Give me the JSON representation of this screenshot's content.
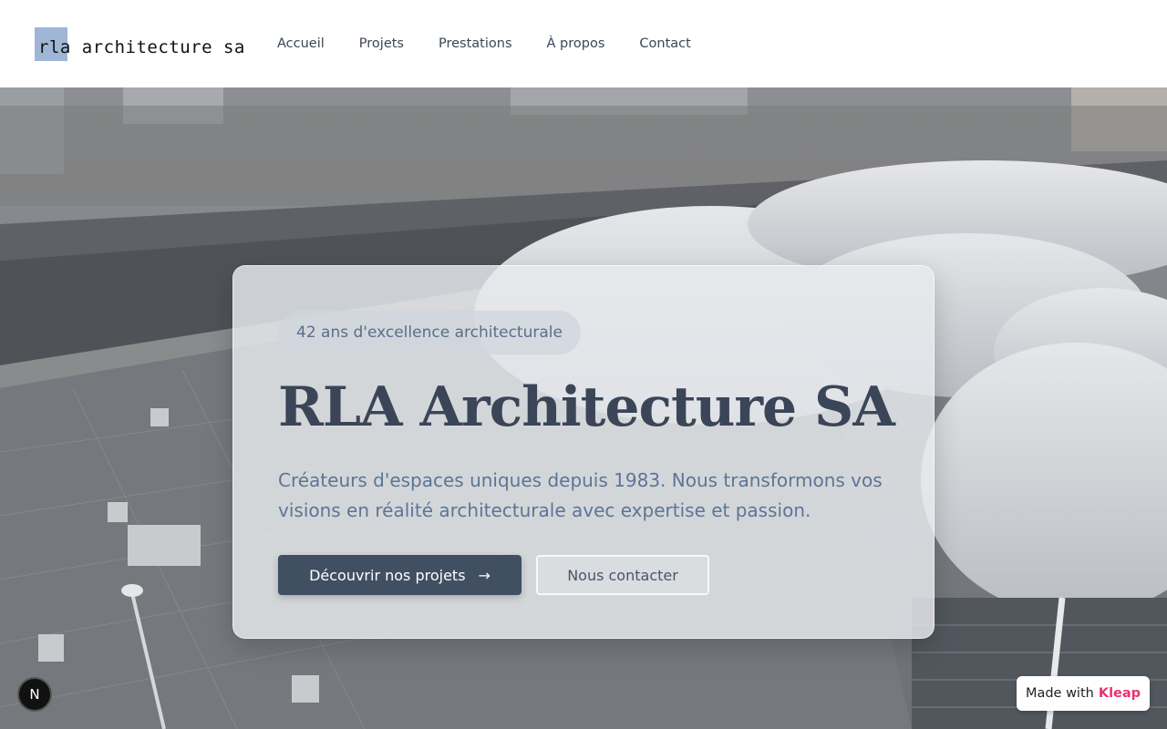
{
  "header": {
    "logo_text": "rla architecture sa",
    "nav": [
      "Accueil",
      "Projets",
      "Prestations",
      "À propos",
      "Contact"
    ]
  },
  "hero": {
    "badge": "42 ans d'excellence architecturale",
    "title": "RLA Architecture SA",
    "description": "Créateurs d'espaces uniques depuis 1983. Nous transformons vos visions en réalité architecturale avec expertise et passion.",
    "primary_button": "Découvrir nos projets",
    "primary_button_icon": "→",
    "secondary_button": "Nous contacter"
  },
  "footer_badges": {
    "n_badge": "N",
    "made_with": "Made with",
    "brand": "Kleap"
  },
  "colors": {
    "primary": "#414f63",
    "accent": "#e8336d",
    "logo_mark": "#9fb6d6"
  }
}
